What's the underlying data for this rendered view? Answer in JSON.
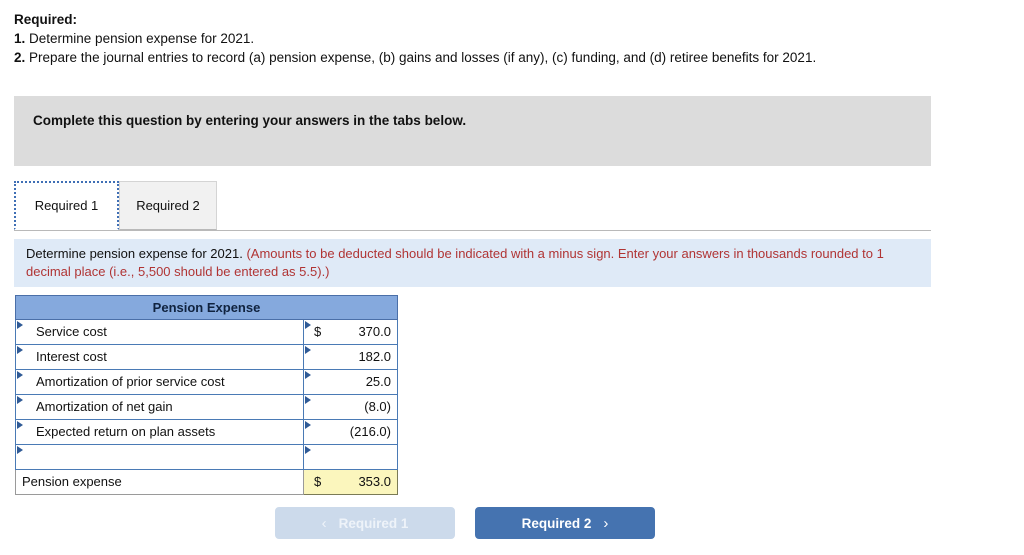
{
  "prompt": {
    "heading": "Required:",
    "items": [
      {
        "num": "1.",
        "text": "Determine pension expense for 2021."
      },
      {
        "num": "2.",
        "text": "Prepare the journal entries to record (a) pension expense, (b) gains and losses (if any), (c) funding, and (d) retiree benefits for 2021."
      }
    ]
  },
  "banner": {
    "text": "Complete this question by entering your answers in the tabs below."
  },
  "tabs": [
    {
      "label": "Required 1",
      "active": true
    },
    {
      "label": "Required 2",
      "active": false
    }
  ],
  "instruction": {
    "main": "Determine pension expense for 2021.",
    "note": "(Amounts to be deducted should be indicated with a minus sign. Enter your answers in thousands rounded to 1 decimal place (i.e., 5,500 should be entered as 5.5).)"
  },
  "table": {
    "header": "Pension Expense",
    "rows": [
      {
        "label": "Service cost",
        "symbol": "$",
        "value": "370.0"
      },
      {
        "label": "Interest cost",
        "symbol": "",
        "value": "182.0"
      },
      {
        "label": "Amortization of prior service cost",
        "symbol": "",
        "value": "25.0"
      },
      {
        "label": "Amortization of net gain",
        "symbol": "",
        "value": "(8.0)"
      },
      {
        "label": "Expected return on plan assets",
        "symbol": "",
        "value": "(216.0)"
      },
      {
        "label": "",
        "symbol": "",
        "value": ""
      }
    ],
    "total": {
      "label": "Pension expense",
      "symbol": "$",
      "value": "353.0"
    }
  },
  "nav": {
    "prev_label": "Required 1",
    "prev_chevron": "‹",
    "next_label": "Required 2",
    "next_chevron": "›"
  },
  "colors": {
    "header_blue": "#85a9dd",
    "cell_border_blue": "#4a7ab5",
    "banner_gray": "#dcdcdc",
    "instruction_blue": "#dfeaf7",
    "note_red": "#b03434",
    "total_yellow": "#fbf6bd",
    "button_blue": "#4573b0",
    "button_disabled": "#ccdaeb"
  }
}
